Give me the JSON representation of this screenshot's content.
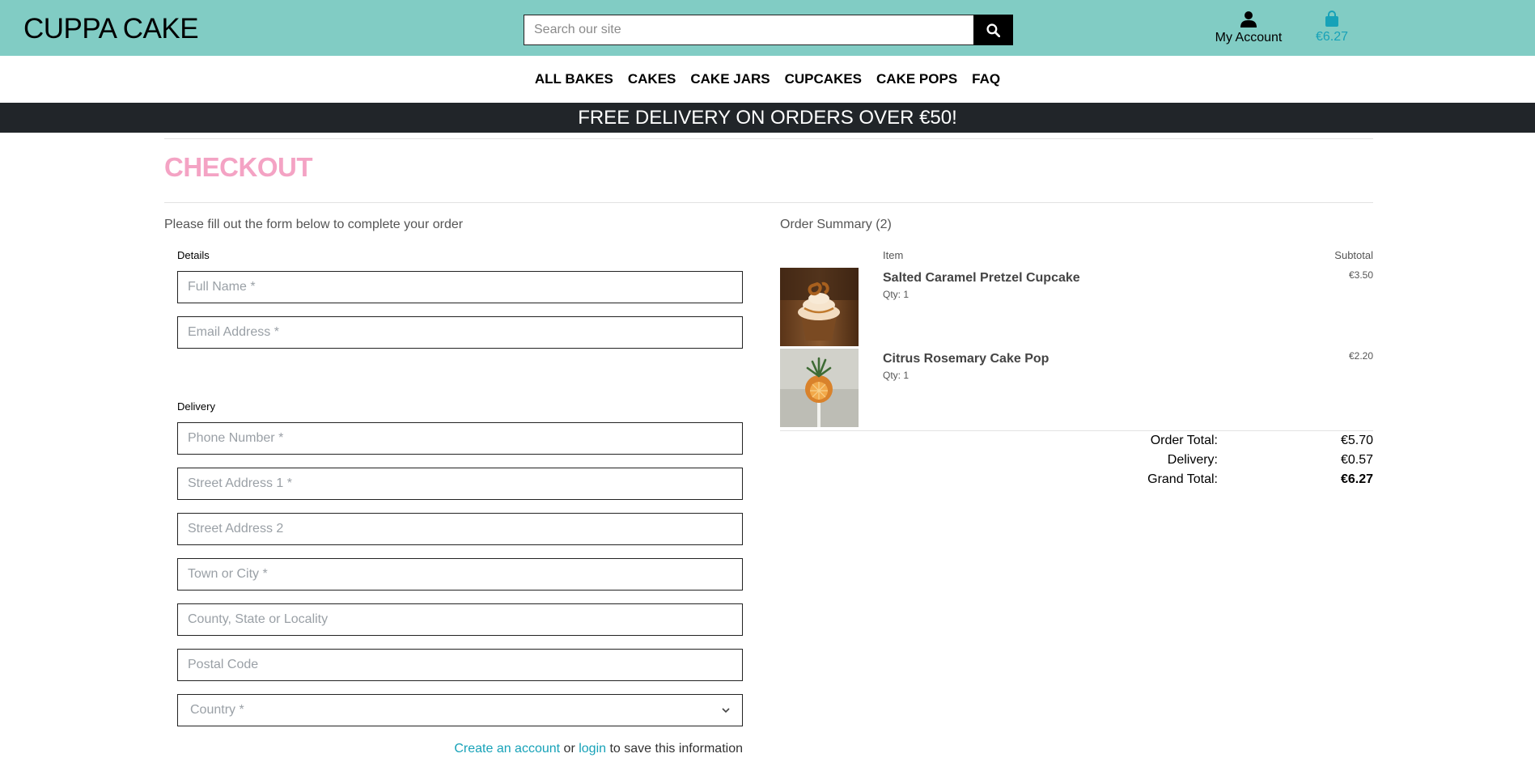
{
  "header": {
    "logo": "CUPPA CAKE",
    "search_placeholder": "Search our site",
    "account_label": "My Account",
    "bag_total": "€6.27"
  },
  "nav": {
    "items": [
      {
        "label": "ALL BAKES"
      },
      {
        "label": "CAKES"
      },
      {
        "label": "CAKE JARS"
      },
      {
        "label": "CUPCAKES"
      },
      {
        "label": "CAKE POPS"
      },
      {
        "label": "FAQ"
      }
    ]
  },
  "banner": {
    "text": "FREE DELIVERY ON ORDERS OVER €50!"
  },
  "page": {
    "title": "CHECKOUT",
    "intro": "Please fill out the form below to complete your order"
  },
  "form": {
    "details_legend": "Details",
    "full_name_placeholder": "Full Name *",
    "email_placeholder": "Email Address *",
    "delivery_legend": "Delivery",
    "phone_placeholder": "Phone Number *",
    "street1_placeholder": "Street Address 1 *",
    "street2_placeholder": "Street Address 2",
    "town_placeholder": "Town or City *",
    "county_placeholder": "County, State or Locality",
    "postcode_placeholder": "Postal Code",
    "country_selected": "Country *",
    "save_create": "Create an account",
    "save_or": " or ",
    "save_login": "login",
    "save_suffix": " to save this information"
  },
  "summary": {
    "title": "Order Summary (2)",
    "col_item": "Item",
    "col_subtotal": "Subtotal",
    "items": [
      {
        "name": "Salted Caramel Pretzel Cupcake",
        "qty": "Qty: 1",
        "subtotal": "€3.50"
      },
      {
        "name": "Citrus Rosemary Cake Pop",
        "qty": "Qty: 1",
        "subtotal": "€2.20"
      }
    ],
    "order_total_label": "Order Total:",
    "order_total": "€5.70",
    "delivery_label": "Delivery:",
    "delivery": "€0.57",
    "grand_total_label": "Grand Total:",
    "grand_total": "€6.27"
  },
  "colors": {
    "header_bg": "#81ccc4",
    "banner_bg": "#212529",
    "title_pink": "#f4a3c4",
    "link_teal": "#17a2b8"
  }
}
